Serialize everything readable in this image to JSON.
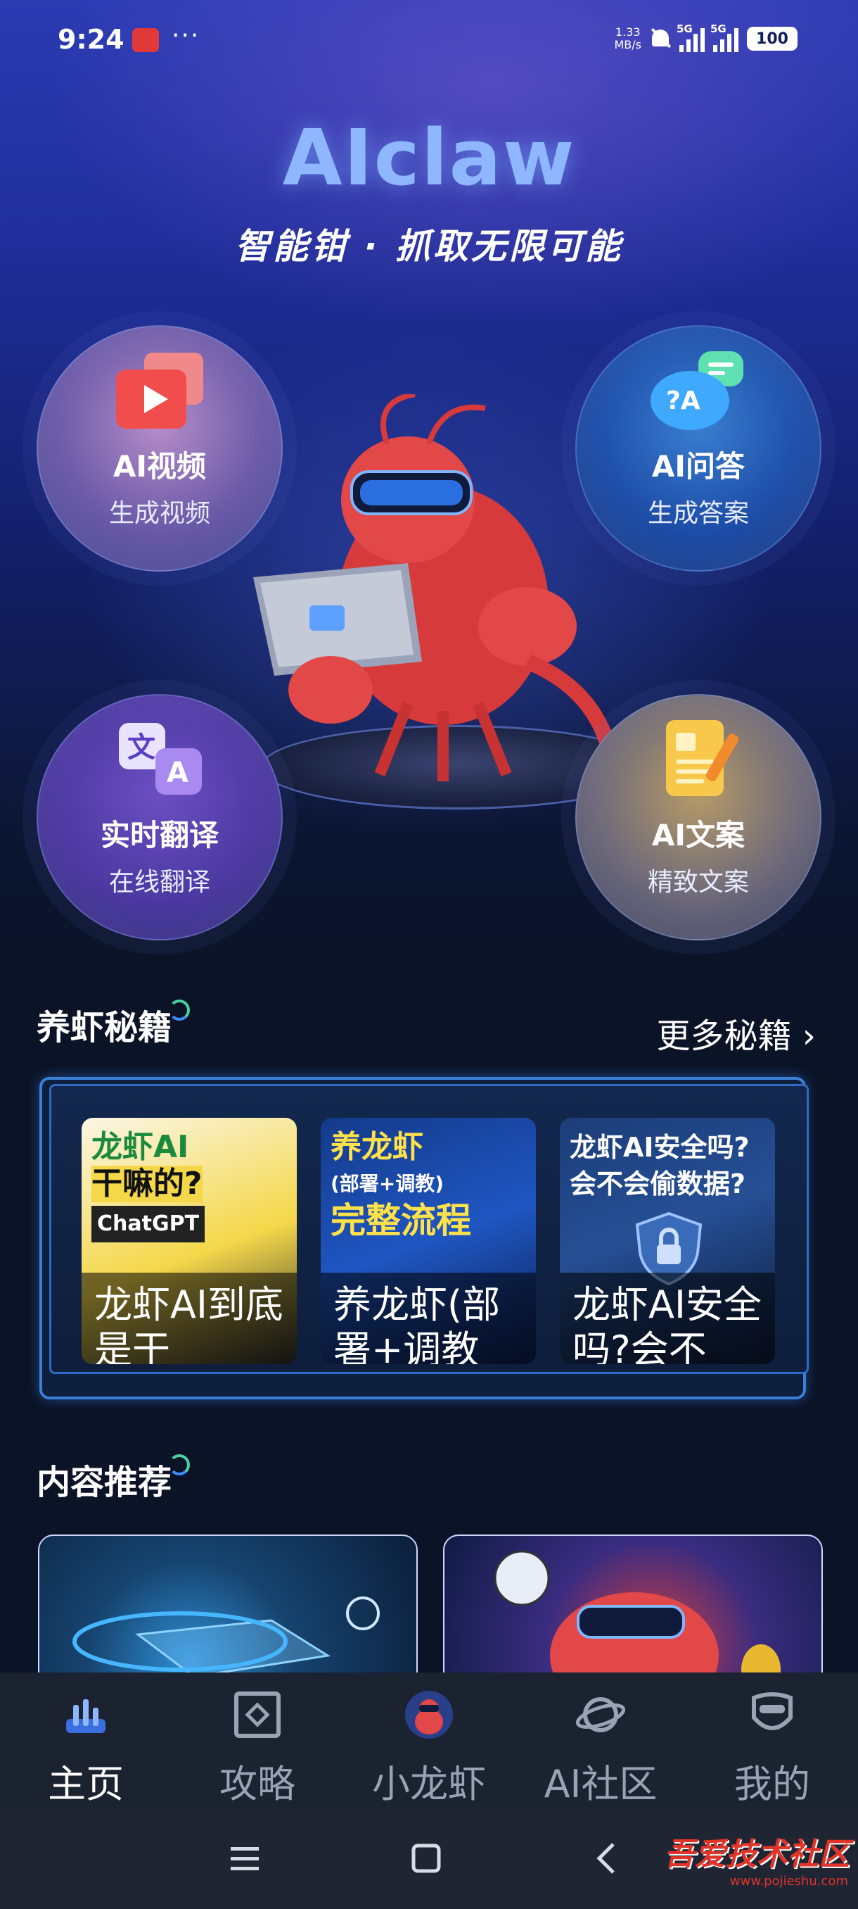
{
  "status_bar": {
    "time": "9:24",
    "net_speed_value": "1.33",
    "net_speed_unit": "MB/s",
    "sim1": "5G",
    "sim2": "5G",
    "battery": "100"
  },
  "header": {
    "app_name": "AIclaw",
    "tagline": "智能钳 · 抓取无限可能"
  },
  "features": [
    {
      "title": "AI视频",
      "subtitle": "生成视频",
      "icon": "video-icon"
    },
    {
      "title": "AI问答",
      "subtitle": "生成答案",
      "icon": "chat-qa-icon"
    },
    {
      "title": "实时翻译",
      "subtitle": "在线翻译",
      "icon": "translate-icon"
    },
    {
      "title": "AI文案",
      "subtitle": "精致文案",
      "icon": "document-pen-icon"
    }
  ],
  "guides": {
    "title": "养虾秘籍",
    "more_label": "更多秘籍",
    "cards": [
      {
        "cover_line1": "龙虾AI",
        "cover_line2": "干嘛的?",
        "cover_line3": "ChatGPT",
        "caption": "龙虾AI到底是干"
      },
      {
        "cover_line1": "养龙虾",
        "cover_line2": "完整流程",
        "cover_line3": "(部署+调教)",
        "caption": "养龙虾(部署+调教"
      },
      {
        "cover_line1": "龙虾AI安全吗?",
        "cover_line2": "会不会偷数据?",
        "cover_line3": "",
        "caption": "龙虾AI安全吗?会不"
      }
    ]
  },
  "recommended": {
    "title": "内容推荐"
  },
  "nav": {
    "items": [
      {
        "label": "主页",
        "icon": "home-bars-icon",
        "active": true
      },
      {
        "label": "攻略",
        "icon": "guide-icon",
        "active": false
      },
      {
        "label": "小龙虾",
        "icon": "lobster-avatar-icon",
        "active": false
      },
      {
        "label": "AI社区",
        "icon": "planet-icon",
        "active": false
      },
      {
        "label": "我的",
        "icon": "profile-mask-icon",
        "active": false
      }
    ]
  },
  "watermark": {
    "text": "吾爱技术社区",
    "url": "www.pojieshu.com"
  },
  "colors": {
    "accent_blue": "#3b7fd8",
    "title_blue": "#8fb7ff",
    "nav_bg": "#1b2230",
    "page_bg": "#0b1326"
  }
}
